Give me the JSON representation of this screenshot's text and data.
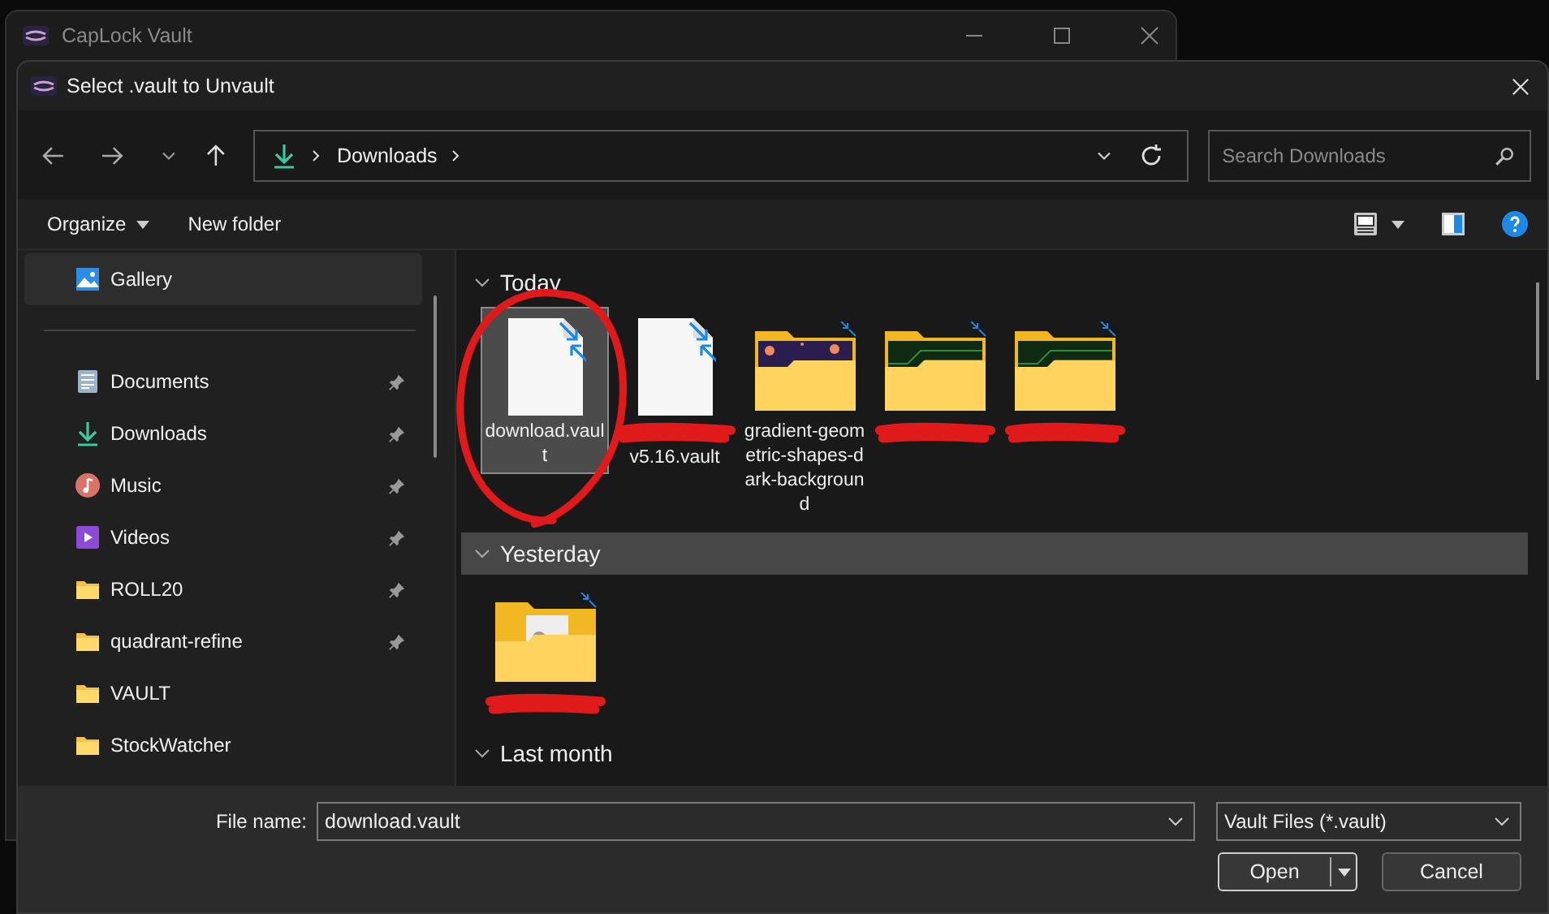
{
  "background_window": {
    "title": "CapLock Vault"
  },
  "dialog": {
    "title": "Select .vault to Unvault"
  },
  "address_bar": {
    "path": [
      "Downloads"
    ]
  },
  "search": {
    "placeholder": "Search Downloads"
  },
  "toolbar": {
    "organize": "Organize",
    "new_folder": "New folder"
  },
  "sidebar": {
    "sections": [
      {
        "items": [
          {
            "label": "Gallery",
            "kind": "gallery",
            "selected": true,
            "pinned": false
          }
        ]
      },
      {
        "items": [
          {
            "label": "Documents",
            "kind": "documents",
            "selected": false,
            "pinned": true
          },
          {
            "label": "Downloads",
            "kind": "downloads",
            "selected": false,
            "pinned": true
          },
          {
            "label": "Music",
            "kind": "music",
            "selected": false,
            "pinned": true
          },
          {
            "label": "Videos",
            "kind": "videos",
            "selected": false,
            "pinned": true
          },
          {
            "label": "ROLL20",
            "kind": "folder",
            "selected": false,
            "pinned": true
          },
          {
            "label": "quadrant-refine",
            "kind": "folder",
            "selected": false,
            "pinned": true
          },
          {
            "label": "VAULT",
            "kind": "folder",
            "selected": false,
            "pinned": false
          },
          {
            "label": "StockWatcher",
            "kind": "folder",
            "selected": false,
            "pinned": false
          }
        ]
      }
    ]
  },
  "groups": [
    {
      "title": "Today",
      "highlighted": false,
      "items": [
        {
          "kind": "file",
          "label": "download.vault",
          "selected": true,
          "redacted": false
        },
        {
          "kind": "file",
          "label": "v5.16.vault",
          "selected": false,
          "redacted": true
        },
        {
          "kind": "spacefolder",
          "label": "gradient-geometric-shapes-dark-background",
          "selected": false,
          "redacted": false
        },
        {
          "kind": "circuitfolder",
          "selected": false,
          "redacted": true
        },
        {
          "kind": "circuitfolder",
          "selected": false,
          "redacted": true
        }
      ]
    },
    {
      "title": "Yesterday",
      "highlighted": true,
      "items": [
        {
          "kind": "docfolder",
          "selected": false,
          "redacted": true
        }
      ]
    },
    {
      "title": "Last month",
      "highlighted": false
    }
  ],
  "file_name": {
    "label": "File name:",
    "value": "download.vault"
  },
  "filter": {
    "value": "Vault Files (*.vault)"
  },
  "buttons": [
    {
      "label": "Open",
      "kind": "split",
      "default": true
    },
    {
      "label": "Cancel",
      "kind": "plain",
      "default": false
    }
  ]
}
